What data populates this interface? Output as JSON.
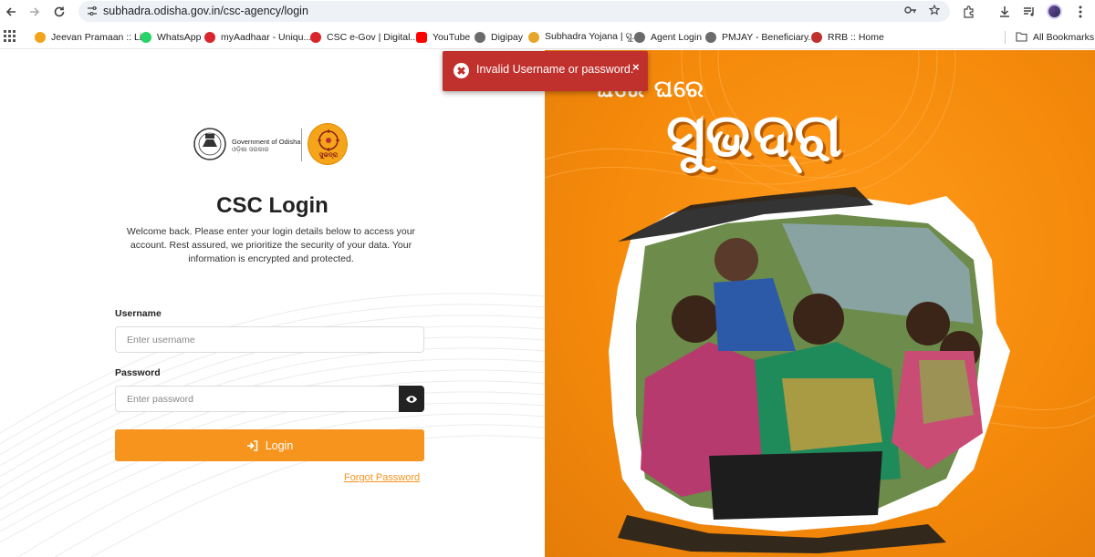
{
  "browser": {
    "url": "subhadra.odisha.gov.in/csc-agency/login",
    "bookmarks": [
      {
        "label": "Jeevan Pramaan :: Li...",
        "color": "#f2a21b"
      },
      {
        "label": "WhatsApp",
        "color": "#25d366"
      },
      {
        "label": "myAadhaar - Uniqu...",
        "color": "#d9262c"
      },
      {
        "label": "CSC e-Gov | Digital...",
        "color": "#d9262c"
      },
      {
        "label": "YouTube",
        "color": "#ff0000"
      },
      {
        "label": "Digipay",
        "color": "#6b6b6b"
      },
      {
        "label": "Subhadra Yojana | ସୁ...",
        "color": "#e5a62a"
      },
      {
        "label": "Agent Login",
        "color": "#6b6b6b"
      },
      {
        "label": "PMJAY - Beneficiary...",
        "color": "#6b6b6b"
      },
      {
        "label": "RRB :: Home",
        "color": "#c0302c"
      }
    ],
    "all_bookmarks": "All Bookmarks"
  },
  "logo": {
    "gov_name": "Government of Odisha",
    "gov_name_odia": "ଓଡ଼ିଶା ସରକାର",
    "scheme_label": "ସୁଭଦ୍ରା"
  },
  "login": {
    "title": "CSC Login",
    "description": "Welcome back. Please enter your login details below to access your account. Rest assured, we prioritize the security of your data. Your information is encrypted and protected.",
    "username_label": "Username",
    "username_placeholder": "Enter username",
    "password_label": "Password",
    "password_placeholder": "Enter password",
    "login_button": "Login",
    "forgot_password": "Forgot Password"
  },
  "banner": {
    "headline": "ଘରେ ଘରେ",
    "title": "ସୁଭଦ୍ରା"
  },
  "toast": {
    "message": "Invalid Username or password.",
    "close": "×",
    "icon": "✖"
  },
  "colors": {
    "accent": "#f7941d",
    "toast": "#c0302c",
    "banner": "#f58a0b"
  }
}
